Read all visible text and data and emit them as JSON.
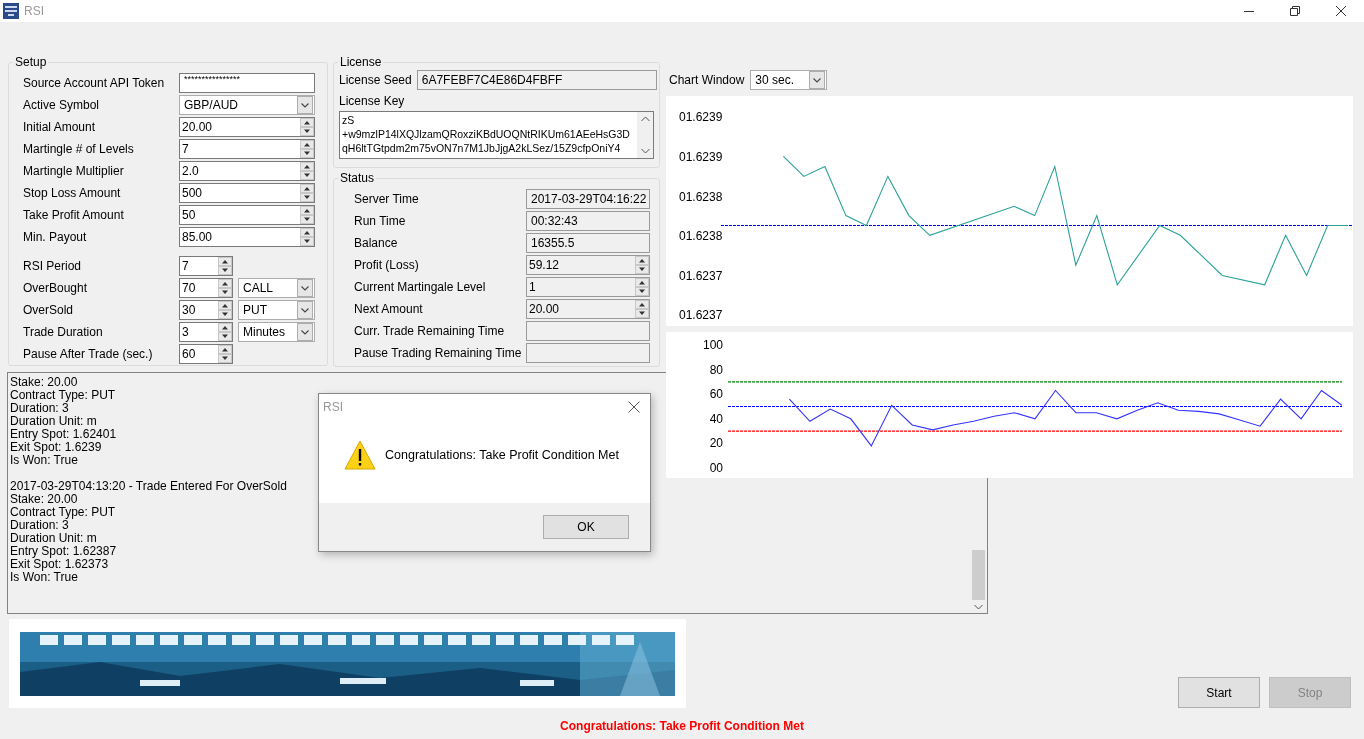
{
  "window": {
    "title": "RSI"
  },
  "setup": {
    "title": "Setup",
    "fields": [
      {
        "label": "Source Account API Token",
        "kind": "password",
        "value": "****************"
      },
      {
        "label": "Active Symbol",
        "kind": "combo",
        "value": "GBP/AUD"
      },
      {
        "label": "Initial Amount",
        "kind": "spin",
        "value": "20.00"
      },
      {
        "label": "Martingle # of Levels",
        "kind": "spin",
        "value": "7"
      },
      {
        "label": "Martingle Multiplier",
        "kind": "spin",
        "value": "2.0"
      },
      {
        "label": "Stop Loss Amount",
        "kind": "spin",
        "value": "500"
      },
      {
        "label": "Take Profit Amount",
        "kind": "spin",
        "value": "50"
      },
      {
        "label": "Min. Payout",
        "kind": "spin",
        "value": "85.00"
      }
    ],
    "rsi_fields": [
      {
        "label": "RSI Period",
        "value": "7"
      },
      {
        "label": "OverBought",
        "value": "70",
        "combo": "CALL"
      },
      {
        "label": "OverSold",
        "value": "30",
        "combo": "PUT"
      },
      {
        "label": "Trade Duration",
        "value": "3",
        "combo": "Minutes"
      },
      {
        "label": "Pause After Trade (sec.)",
        "value": "60"
      }
    ]
  },
  "license": {
    "title": "License",
    "seed_label": "License Seed",
    "seed": "6A7FEBF7C4E86D4FBFF",
    "key_label": "License Key",
    "key_lines": [
      "zS",
      "+w9mzlP14lXQJlzamQRoxziKBdUOQNtRIKUm61AEeHsG3D",
      "qH6ltTGtpdm2m75vON7n7M1JbJjgA2kLSez/15Z9cfpOniY4"
    ]
  },
  "status": {
    "title": "Status",
    "rows": [
      {
        "label": "Server Time",
        "kind": "text",
        "value": "2017-03-29T04:16:22"
      },
      {
        "label": "Run Time",
        "kind": "text",
        "value": "00:32:43"
      },
      {
        "label": "Balance",
        "kind": "text",
        "value": "16355.5"
      },
      {
        "label": "Profit (Loss)",
        "kind": "spin",
        "value": "59.12"
      },
      {
        "label": "Current Martingale Level",
        "kind": "spin",
        "value": "1"
      },
      {
        "label": "Next Amount",
        "kind": "spin",
        "value": "20.00"
      },
      {
        "label": "Curr. Trade Remaining Time",
        "kind": "text"
      },
      {
        "label": "Pause Trading Remaining Time",
        "kind": "text"
      }
    ]
  },
  "chart_window": {
    "label": "Chart Window",
    "value": "30 sec."
  },
  "price_chart": {
    "tick_labels": [
      "01.6239",
      "01.6239",
      "01.6238",
      "01.6238",
      "01.6237",
      "01.6237"
    ]
  },
  "rsi_chart": {
    "chart_data": {
      "type": "line",
      "categories": [
        null,
        null,
        null,
        null,
        null,
        null,
        null,
        null,
        null,
        null,
        null,
        null,
        null,
        null,
        null,
        null,
        null,
        null,
        null,
        null,
        null,
        null,
        null,
        null,
        null,
        null,
        null,
        null,
        null,
        null,
        null
      ],
      "series": [
        {
          "color": "#008000",
          "line_style": "dashed",
          "values": [
            70,
            70,
            70,
            70,
            70,
            70,
            70,
            70,
            70,
            70,
            70,
            70,
            70,
            70,
            70,
            70,
            70,
            70,
            70,
            70,
            70,
            70,
            70,
            70,
            70,
            70,
            70,
            70,
            70,
            70,
            70
          ]
        },
        {
          "color": "#0000ff",
          "line_style": "dashed",
          "values": [
            50,
            50,
            50,
            50,
            50,
            50,
            50,
            50,
            50,
            50,
            50,
            50,
            50,
            50,
            50,
            50,
            50,
            50,
            50,
            50,
            50,
            50,
            50,
            50,
            50,
            50,
            50,
            50,
            50,
            50,
            50
          ]
        },
        {
          "color": "#ff0000",
          "line_style": "dashed",
          "values": [
            30,
            30,
            30,
            30,
            30,
            30,
            30,
            30,
            30,
            30,
            30,
            30,
            30,
            30,
            30,
            30,
            30,
            30,
            30,
            30,
            30,
            30,
            30,
            30,
            30,
            30,
            30,
            30,
            30,
            30,
            30
          ]
        },
        {
          "color": "#3333ff",
          "line_style": "solid",
          "values": [
            null,
            null,
            null,
            56,
            38,
            48,
            40,
            18,
            51,
            35,
            31,
            35,
            38,
            42,
            45,
            40,
            63,
            45,
            45,
            40,
            47,
            53,
            47,
            46,
            44,
            39,
            34,
            56,
            40,
            63,
            51
          ]
        }
      ],
      "ylim": [
        0,
        100
      ],
      "yticks": [
        {
          "value": 0,
          "label": "00"
        },
        20,
        40,
        60,
        80,
        100
      ]
    }
  },
  "log": {
    "entries": [
      {
        "lines": [
          "Stake: 20.00",
          "Contract Type: PUT",
          "Duration: 3",
          "Duration Unit: m",
          "Entry Spot: 1.62401",
          "Exit Spot: 1.6239",
          "Is Won: True"
        ]
      },
      {
        "lines": [
          "2017-03-29T04:13:20 - Trade Entered For OverSold",
          "Stake: 20.00",
          "Contract Type: PUT",
          "Duration: 3",
          "Duration Unit: m",
          "Entry Spot: 1.62387",
          "Exit Spot: 1.62373",
          "Is Won: True"
        ]
      }
    ]
  },
  "dialog": {
    "title": "RSI",
    "message": "Congratulations: Take Profit Condition Met",
    "button": "OK"
  },
  "buttons": [
    {
      "label": "Start",
      "disabled": false
    },
    {
      "label": "Stop",
      "disabled": true
    }
  ],
  "status_message": "Congratulations: Take Profit Condition Met"
}
